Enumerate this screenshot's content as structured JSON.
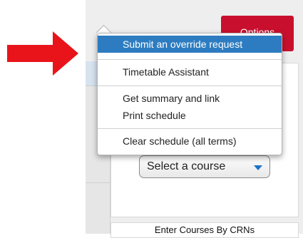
{
  "options_button": {
    "label": "Options"
  },
  "menu": {
    "items": [
      {
        "label": "Submit an override request",
        "active": true
      },
      {
        "label": "Timetable Assistant"
      },
      {
        "label": "Get summary and link"
      },
      {
        "label": "Print schedule"
      },
      {
        "label": "Clear schedule (all terms)"
      }
    ]
  },
  "course_select": {
    "value": "Select a course"
  },
  "footer": {
    "label": "Enter Courses By CRNs"
  },
  "colors": {
    "accent": "#c8102e",
    "menu_highlight": "#2d7cc1",
    "arrow": "#e8141a"
  },
  "icons": {
    "pointer": "red-arrow-icon",
    "select_caret": "chevron-down-icon"
  }
}
